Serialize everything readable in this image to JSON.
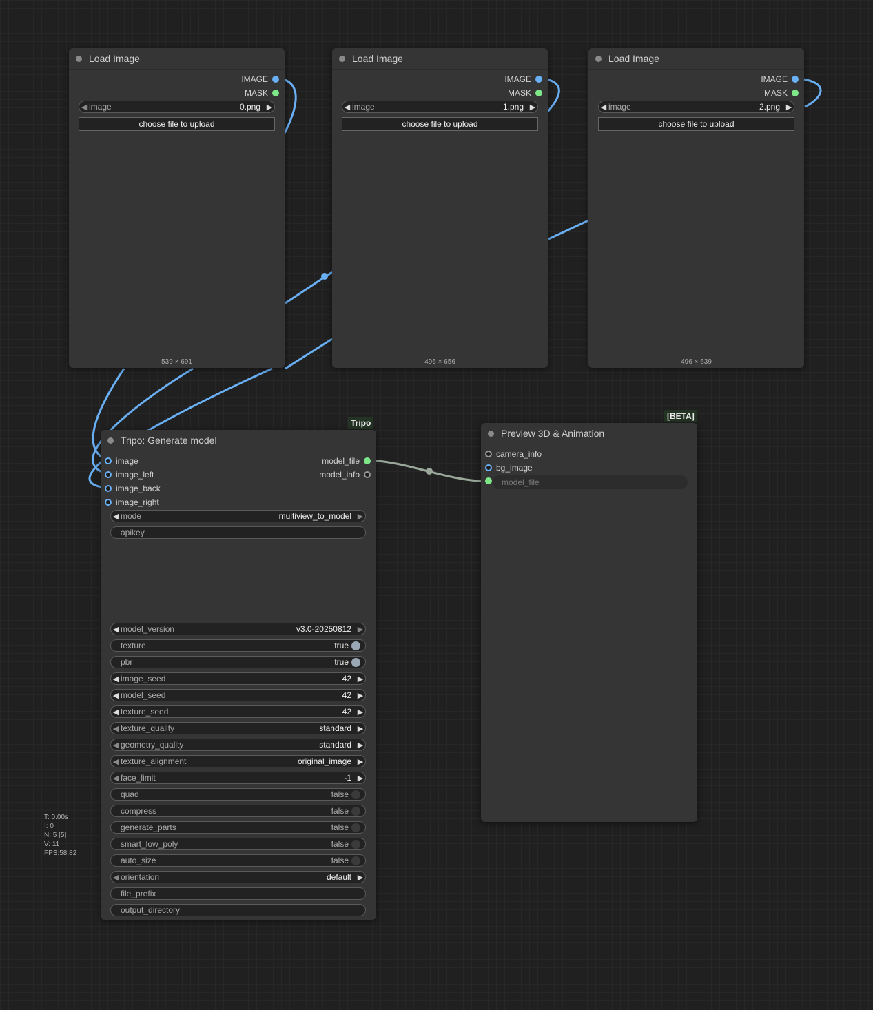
{
  "load_nodes": [
    {
      "title": "Load Image",
      "outputs": [
        "IMAGE",
        "MASK"
      ],
      "image_label": "image",
      "image_value": "0.png",
      "upload_label": "choose file to upload",
      "dims": "539 × 691"
    },
    {
      "title": "Load Image",
      "outputs": [
        "IMAGE",
        "MASK"
      ],
      "image_label": "image",
      "image_value": "1.png",
      "upload_label": "choose file to upload",
      "dims": "496 × 656"
    },
    {
      "title": "Load Image",
      "outputs": [
        "IMAGE",
        "MASK"
      ],
      "image_label": "image",
      "image_value": "2.png",
      "upload_label": "choose file to upload",
      "dims": "496 × 639"
    }
  ],
  "tripo": {
    "badge": "Tripo",
    "title": "Tripo: Generate model",
    "inputs": [
      "image",
      "image_left",
      "image_back",
      "image_right"
    ],
    "outputs": [
      "model_file",
      "model_info"
    ],
    "widgets": {
      "mode": {
        "label": "mode",
        "value": "multiview_to_model"
      },
      "apikey": {
        "label": "apikey"
      },
      "model_version": {
        "label": "model_version",
        "value": "v3.0-20250812"
      },
      "texture": {
        "label": "texture",
        "value": "true"
      },
      "pbr": {
        "label": "pbr",
        "value": "true"
      },
      "image_seed": {
        "label": "image_seed",
        "value": "42"
      },
      "model_seed": {
        "label": "model_seed",
        "value": "42"
      },
      "texture_seed": {
        "label": "texture_seed",
        "value": "42"
      },
      "texture_quality": {
        "label": "texture_quality",
        "value": "standard"
      },
      "geometry_quality": {
        "label": "geometry_quality",
        "value": "standard"
      },
      "texture_alignment": {
        "label": "texture_alignment",
        "value": "original_image"
      },
      "face_limit": {
        "label": "face_limit",
        "value": "-1"
      },
      "quad": {
        "label": "quad",
        "value": "false"
      },
      "compress": {
        "label": "compress",
        "value": "false"
      },
      "generate_parts": {
        "label": "generate_parts",
        "value": "false"
      },
      "smart_low_poly": {
        "label": "smart_low_poly",
        "value": "false"
      },
      "auto_size": {
        "label": "auto_size",
        "value": "false"
      },
      "orientation": {
        "label": "orientation",
        "value": "default"
      },
      "file_prefix": {
        "label": "file_prefix"
      },
      "output_directory": {
        "label": "output_directory"
      }
    }
  },
  "preview": {
    "badge": "[BETA]",
    "title": "Preview 3D & Animation",
    "inputs": [
      "camera_info",
      "bg_image",
      "model_file"
    ]
  },
  "stats": [
    "T: 0.00s",
    "I: 0",
    "N: 5 [5]",
    "V: 11",
    "FPS:58.82"
  ],
  "colors": {
    "image_link": "#6ab0f5",
    "model_link": "#9aa89a",
    "background": "#202020",
    "node": "#353535"
  }
}
